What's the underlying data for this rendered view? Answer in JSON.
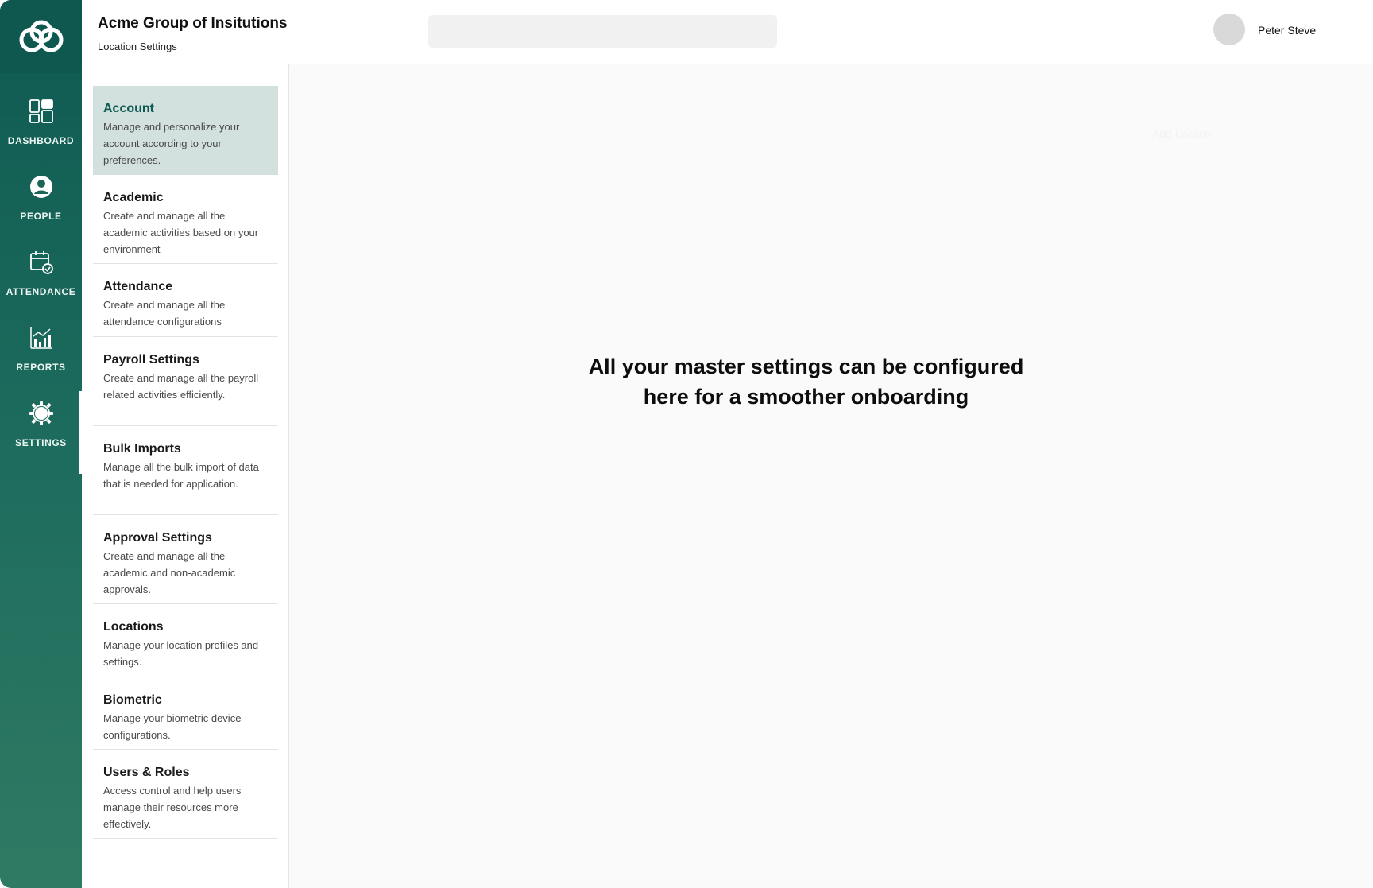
{
  "rail": {
    "items": [
      {
        "label": "DASHBOARD",
        "icon": "dashboard-icon"
      },
      {
        "label": "PEOPLE",
        "icon": "person-icon"
      },
      {
        "label": "ATTENDANCE",
        "icon": "calendar-check-icon"
      },
      {
        "label": "REPORTS",
        "icon": "chart-icon"
      },
      {
        "label": "SETTINGS",
        "icon": "gear-icon"
      }
    ],
    "active": "SETTINGS"
  },
  "header": {
    "org_name": "Acme Group of Insitutions",
    "page_subtitle": "Location Settings",
    "search_placeholder": "",
    "user_name": "Peter Steve"
  },
  "settings_menu": [
    {
      "title": "Account",
      "description": "Manage and personalize your account according to your preferences.",
      "active": true
    },
    {
      "title": "Academic",
      "description": "Create and manage all the academic activities based on your environment"
    },
    {
      "title": "Attendance",
      "description": "Create and manage all the attendance configurations"
    },
    {
      "title": "Payroll Settings",
      "description": "Create and manage all the payroll related activities efficiently."
    },
    {
      "title": "Bulk Imports",
      "description": "Manage all the bulk import of data that is needed for application."
    },
    {
      "title": "Approval Settings",
      "description": "Create and manage all the academic and non-academic approvals."
    },
    {
      "title": "Locations",
      "description": "Manage your location profiles and settings."
    },
    {
      "title": "Biometric",
      "description": "Manage your biometric device configurations."
    },
    {
      "title": "Users & Roles",
      "description": "Access control and help users manage their resources more effectively."
    }
  ],
  "main": {
    "headline_line1": "All your master settings can be configured",
    "headline_line2": "here for a smoother onboarding",
    "faint_button": "Add Locatio"
  },
  "colors": {
    "rail_top": "#0f5a52",
    "rail_bottom": "#2f7a63",
    "active_item_bg": "#d2e0de"
  }
}
